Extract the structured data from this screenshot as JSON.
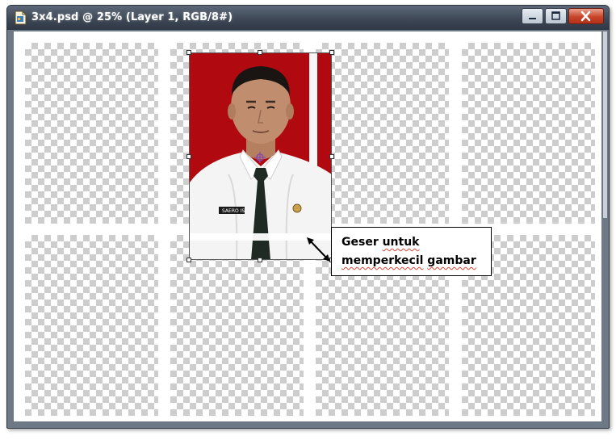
{
  "window": {
    "title": "3x4.psd @ 25% (Layer 1, RGB/8#)",
    "controls": {
      "minimize": "minimize",
      "maximize": "maximize",
      "close": "close"
    }
  },
  "canvas": {
    "background": "transparent-checkerboard",
    "grid": {
      "columns": 4,
      "rows": 2
    }
  },
  "photo": {
    "background_color": "#b0090f",
    "shirt_color": "#f4f4f4",
    "tie_color": "#1f2a24",
    "name_tag": "SAERO IS"
  },
  "callout": {
    "line1_word1": "Geser",
    "line1_word2": "untuk",
    "line2_word1": "memperkecil",
    "line2_word2": "gambar"
  },
  "icons": [
    "photoshop-document-icon",
    "minimize-icon",
    "maximize-icon",
    "close-icon",
    "arrow-icon",
    "pivot-icon"
  ],
  "colors": {
    "title_bar": "#3e4856",
    "close_button": "#c8452a",
    "checker": "#cdcdcd"
  }
}
